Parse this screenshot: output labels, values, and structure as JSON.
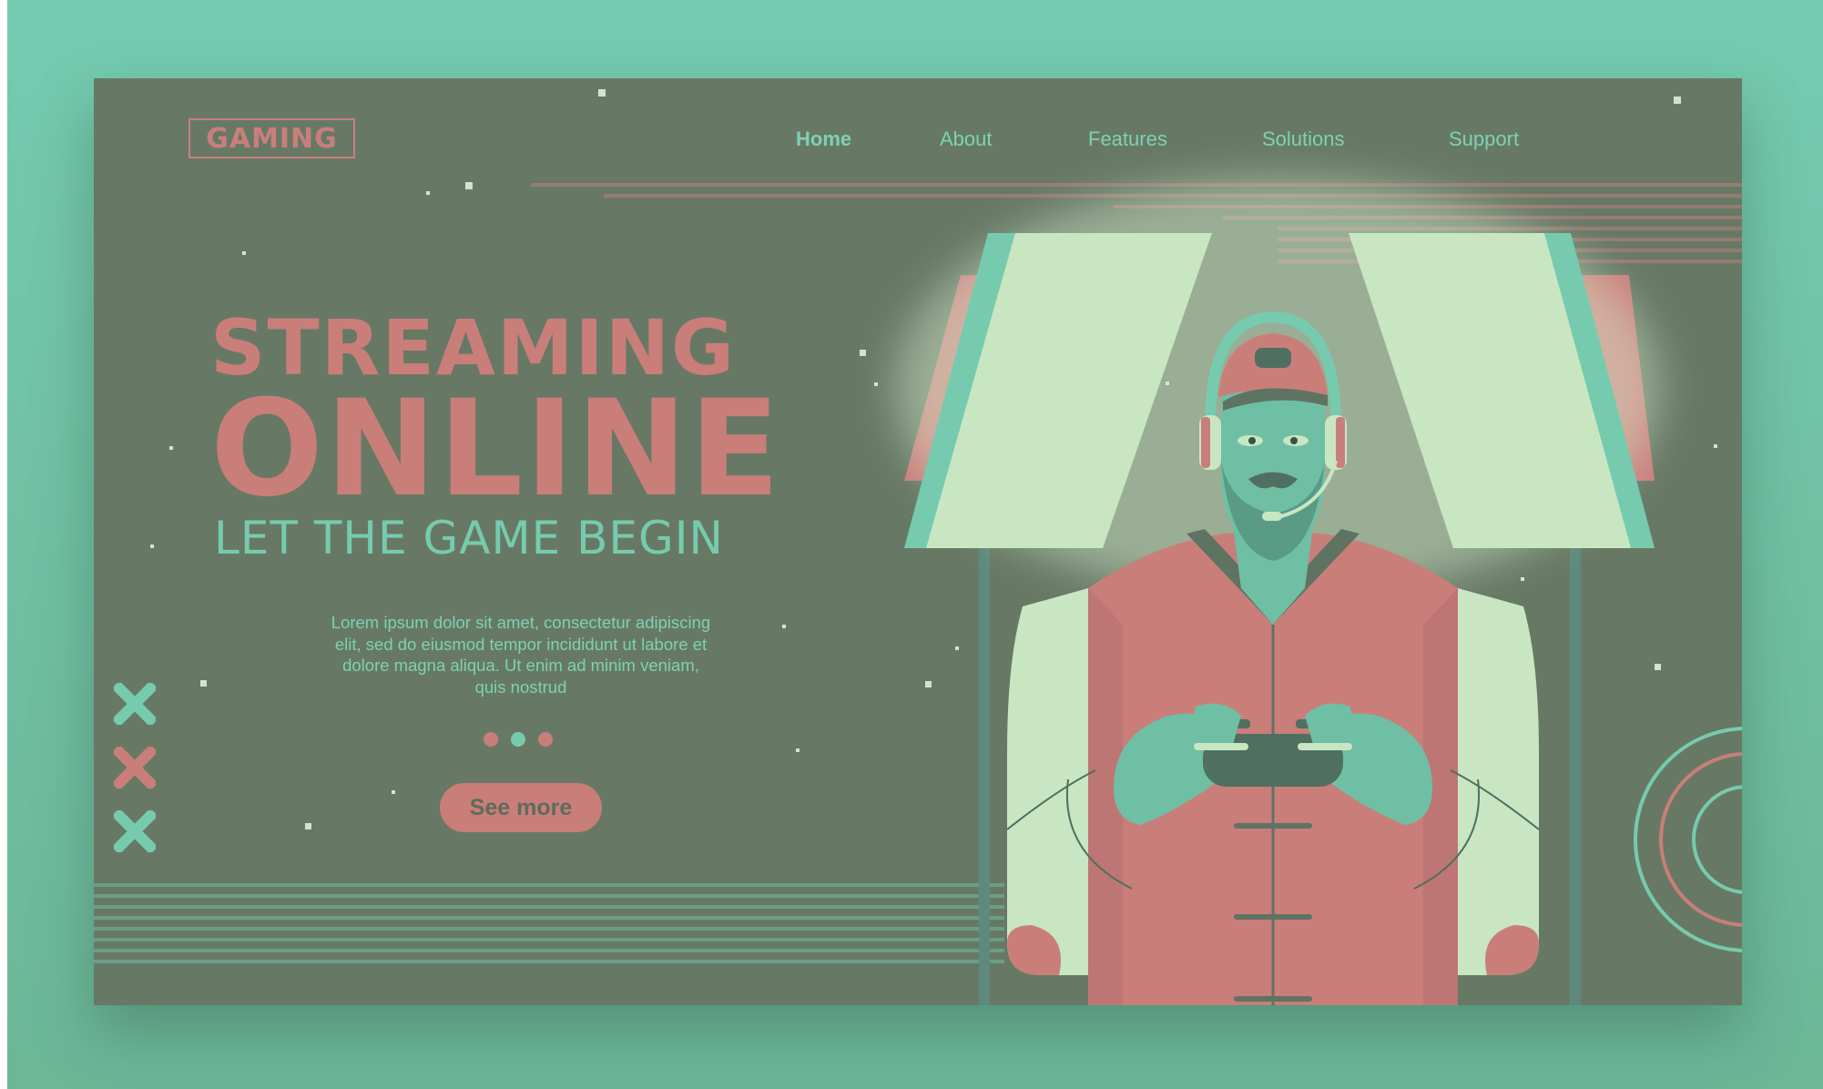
{
  "logo": {
    "text": "GAMING"
  },
  "nav": {
    "items": [
      {
        "label": "Home",
        "active": true
      },
      {
        "label": "About",
        "active": false
      },
      {
        "label": "Features",
        "active": false
      },
      {
        "label": "Solutions",
        "active": false
      },
      {
        "label": "Support",
        "active": false
      }
    ]
  },
  "hero": {
    "title_line1": "STREAMING",
    "title_line2": "ONLINE",
    "subtitle": "LET THE GAME BEGIN",
    "body": "Lorem ipsum dolor sit amet, consectetur adipiscing elit, sed do eiusmod tempor incididunt ut labore et dolore magna aliqua. Ut enim ad minim veniam, quis nostrud",
    "cta_label": "See more"
  },
  "carousel": {
    "dot_colors": [
      "#c97e7a",
      "#76cbae",
      "#c97e7a"
    ],
    "active_index": 1
  },
  "colors": {
    "background": "#74cbb0",
    "panel": "#677965",
    "accent_pink": "#c97e7a",
    "accent_teal": "#76cbae",
    "light_green": "#c9e6c3"
  },
  "icons": {
    "side_marks": [
      "x-icon-teal",
      "x-icon-pink",
      "x-icon-teal"
    ],
    "figure": "gamer-with-headset-and-controller",
    "corner": "concentric-circles"
  }
}
